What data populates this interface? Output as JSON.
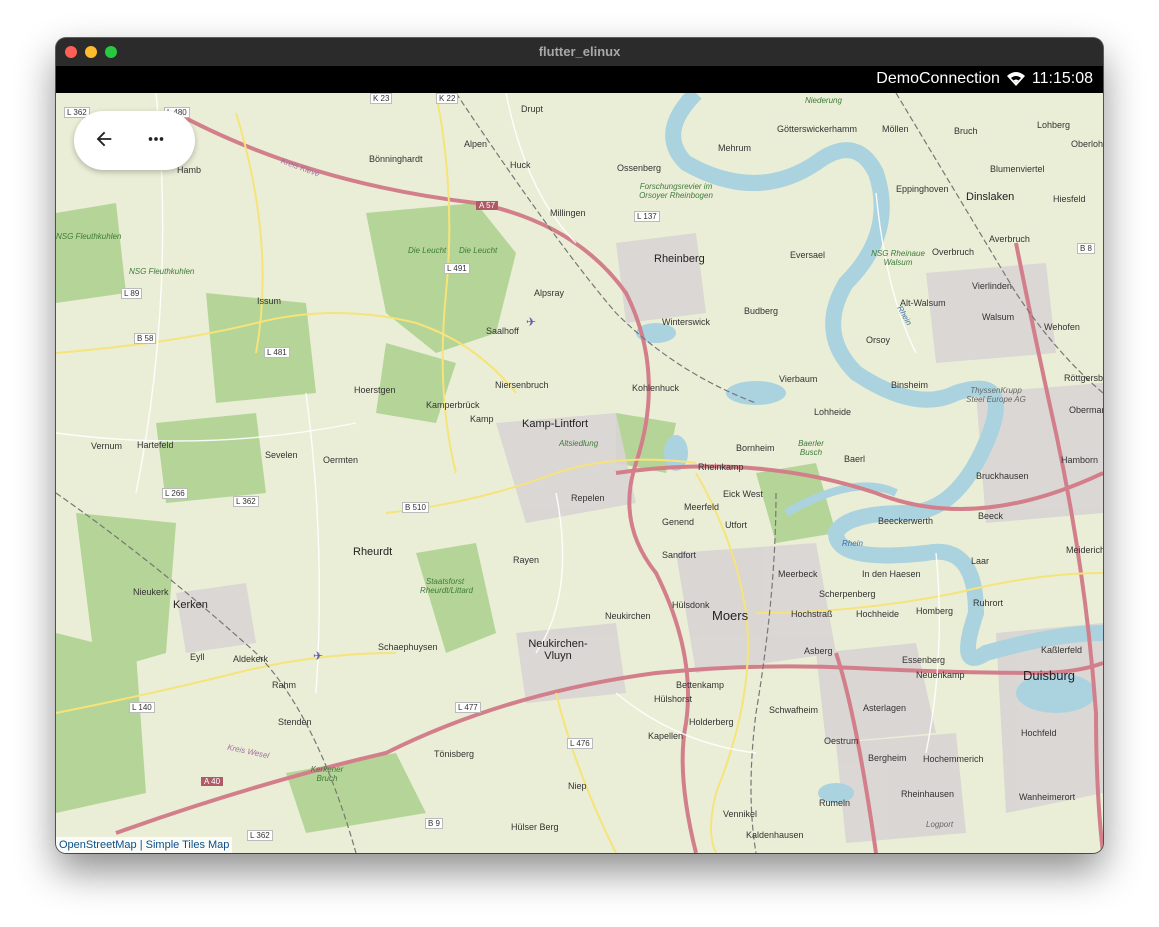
{
  "window": {
    "title": "flutter_elinux"
  },
  "statusbar": {
    "connection": "DemoConnection",
    "time": "11:15:08",
    "wifi_icon": "wifi-icon"
  },
  "toolbar": {
    "back_icon": "arrow-back-icon",
    "more_icon": "more-horiz-icon"
  },
  "attribution": {
    "osm": "OpenStreetMap",
    "separator": "|",
    "tiles": "Simple Tiles Map"
  },
  "map": {
    "cities": [
      {
        "name": "Moers"
      },
      {
        "name": "Duisburg"
      },
      {
        "name": "Rheinberg"
      },
      {
        "name": "Dinslaken"
      },
      {
        "name": "Kamp-Lintfort"
      },
      {
        "name": "Neukirchen-Vluyn"
      },
      {
        "name": "Kerken"
      },
      {
        "name": "Rheurdt"
      }
    ],
    "towns": [
      "Alpen",
      "Issum",
      "Hoerstgen",
      "Vierbaum",
      "Orsoy",
      "Baerl",
      "Hülsdonk",
      "Rheinkamp",
      "Kapellen",
      "Homberg",
      "Asberg",
      "Budberg",
      "Winterswick",
      "Eick West",
      "Utfort",
      "Meerbeck",
      "Scherpenberg",
      "Hochheide",
      "Essenberg",
      "Neuenkamp",
      "Rumeln",
      "Kaldenhausen",
      "Bergheim",
      "Hochemmerich",
      "Rheinhausen",
      "Vennikel",
      "Hülser Berg",
      "Niep",
      "Tönisberg",
      "Stenden",
      "Rahm",
      "Aldekerk",
      "Eyll",
      "Nieukerk",
      "Vernum",
      "Hartefeld",
      "Sevelen",
      "Oermten",
      "Kamperbrück",
      "Kamp",
      "Niersenbruch",
      "Saalhoff",
      "Alpsray",
      "Millingen",
      "Huck",
      "Drupt",
      "Bönninghardt",
      "Hamb",
      "Ossenberg",
      "Eversael",
      "Mehrum",
      "Götterswickerhamm",
      "Möllen",
      "Bruch",
      "Lohberg",
      "Oberlohberg",
      "Blumenviertel",
      "Eppinghoven",
      "Hiesfeld",
      "Averbruch",
      "Overbruch",
      "Vierlinden",
      "Walsum",
      "Wehofen",
      "Alt-Walsum",
      "Binsheim",
      "Röttgersbach",
      "Obermarxloh",
      "Hamborn",
      "Bruckhausen",
      "Beeck",
      "Laar",
      "Ruhrort",
      "Meiderich",
      "Kaßlerfeld",
      "Hochfeld",
      "Wanheimerort",
      "Beeckerwerth",
      "In den Haesen",
      "Hochstraß",
      "Genend",
      "Meerfeld",
      "Sandfort",
      "Neukirchen",
      "Rayen",
      "Schaephuysen",
      "Bettenkamp",
      "Hülshorst",
      "Holderberg",
      "Schwafheim",
      "Asterlagen",
      "Oestrum",
      "Lohheide",
      "Bornheim",
      "Kohlenhuck",
      "Repelen"
    ],
    "areas": [
      "Die Leucht",
      "Die Leucht",
      "NSG Fleuthkuhlen",
      "NSG Fleuthkuhlen",
      "Staatsforst Rheurdt/Littard",
      "Baerler Busch",
      "Forschungsrevier im Orsoyer Rheinbogen",
      "NSG Rheinaue Walsum",
      "Kerkener Bruch",
      "Altsiedlung",
      "Niederung",
      "ThyssenKrupp Steel Europe AG",
      "Logport"
    ],
    "roads": [
      "L 362",
      "L 480",
      "K 23",
      "K 22",
      "L 89",
      "B 58",
      "L 481",
      "L 491",
      "L 137",
      "A 57",
      "B 510",
      "L 266",
      "L 362",
      "L 477",
      "L 476",
      "L 140",
      "A 40",
      "B 9",
      "L 362",
      "B 8"
    ],
    "water": [
      "Rhein",
      "Kreis Kleve",
      "Kreis Wesel",
      "Rhein"
    ]
  }
}
